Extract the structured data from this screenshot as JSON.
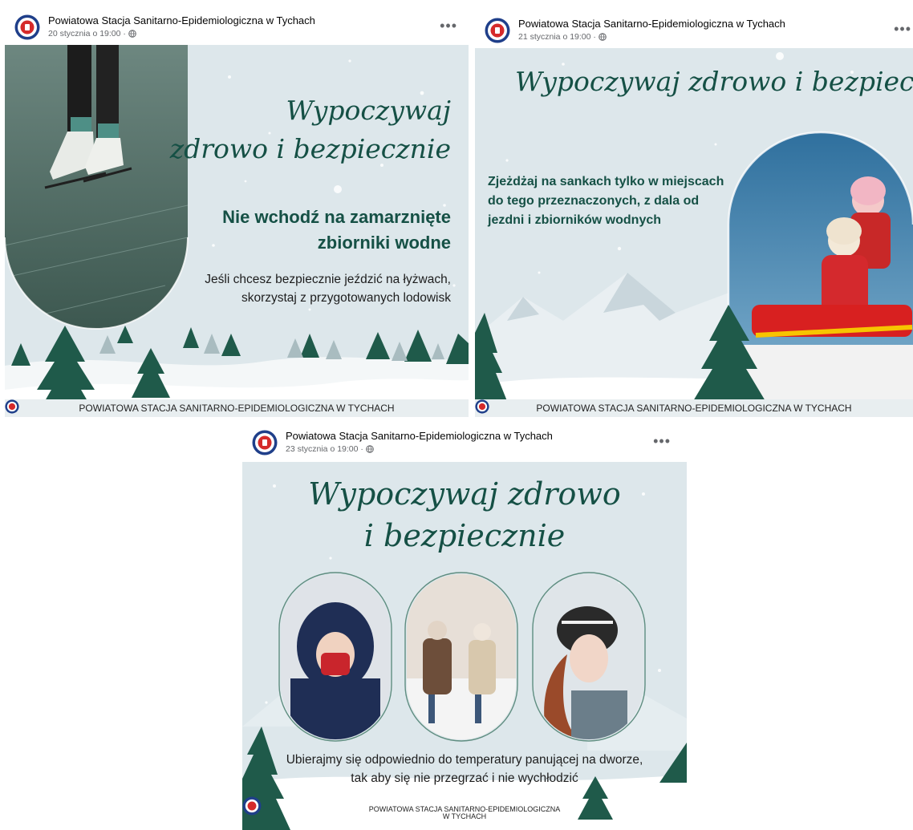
{
  "posts": [
    {
      "author": "Powiatowa Stacja Sanitarno-Epidemiologiczna w Tychach",
      "date": "20 stycznia o 19:00 ·",
      "more": "•••",
      "graphic": {
        "title_line1": "Wypoczywaj",
        "title_line2": "zdrowo i bezpiecznie",
        "headline_line1": "Nie wchodź na zamarznięte",
        "headline_line2": "zbiorniki wodne",
        "body_line1": "Jeśli chcesz bezpiecznie jeździć na łyżwach,",
        "body_line2": "skorzystaj z przygotowanych lodowisk",
        "footer": "POWIATOWA STACJA SANITARNO-EPIDEMIOLOGICZNA W TYCHACH"
      }
    },
    {
      "author": "Powiatowa Stacja Sanitarno-Epidemiologiczna w Tychach",
      "date": "21 stycznia o 19:00 ·",
      "more": "•••",
      "graphic": {
        "title": "Wypoczywaj zdrowo i bezpiecznie",
        "body_line1": "Zjeżdżaj na sankach tylko w miejscach",
        "body_line2": "do tego przeznaczonych, z dala od",
        "body_line3": "jezdni i zbiorników wodnych",
        "footer": "POWIATOWA STACJA SANITARNO-EPIDEMIOLOGICZNA W TYCHACH"
      }
    },
    {
      "author": "Powiatowa Stacja Sanitarno-Epidemiologiczna w Tychach",
      "date": "23 stycznia o 19:00 ·",
      "more": "•••",
      "graphic": {
        "title_line1": "Wypoczywaj zdrowo",
        "title_line2": "i bezpiecznie",
        "body_line1": "Ubierajmy się odpowiednio do temperatury panującej na dworze,",
        "body_line2": "tak aby się nie przegrzać i nie wychłodzić",
        "footer_line1": "POWIATOWA STACJA SANITARNO-EPIDEMIOLOGICZNA",
        "footer_line2": "W TYCHACH"
      }
    }
  ],
  "colors": {
    "brand_green": "#155045",
    "background": "#dde7eb",
    "tree_green": "#1f5a4a",
    "meta_gray": "#65676b"
  },
  "icons": [
    "logo-icon",
    "globe-icon",
    "more-options-icon",
    "tree-icon",
    "mountain-icon"
  ]
}
